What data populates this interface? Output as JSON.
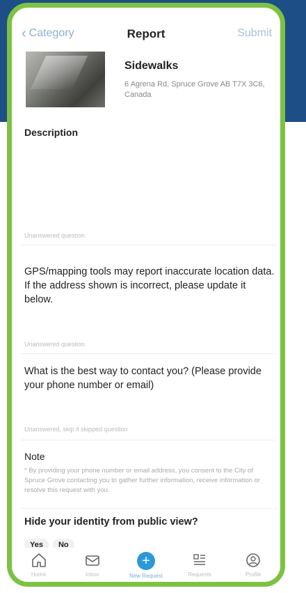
{
  "nav": {
    "back_label": "Category",
    "title": "Report",
    "submit_label": "Submit"
  },
  "report": {
    "category": "Sidewalks",
    "address": "6 Agrena Rd, Spruce Grove AB T7X 3C6, Canada"
  },
  "description": {
    "label": "Description",
    "hint": "Unanswered question"
  },
  "gps": {
    "question": "GPS/mapping tools may report inaccurate location data. If the address shown is incorrect, please update it below.",
    "hint": "Unanswered question"
  },
  "contact": {
    "question": "What is the best way to contact you? (Please provide your phone number or email)",
    "hint": "Unanswered, skip if skipped question"
  },
  "note": {
    "label": "Note",
    "text": "* By providing your phone number or email address, you consent to the City of Spruce Grove contacting you to gather further information, receive information or resolve this request with you."
  },
  "identity": {
    "question": "Hide your identity from public view?",
    "yes": "Yes",
    "no": "No"
  },
  "tabs": [
    {
      "label": "Home",
      "icon": "home-icon"
    },
    {
      "label": "Inbox",
      "icon": "mail-icon"
    },
    {
      "label": "New Request",
      "icon": "plus-icon"
    },
    {
      "label": "Requests",
      "icon": "list-icon"
    },
    {
      "label": "Profile",
      "icon": "profile-icon"
    }
  ],
  "colors": {
    "frame": "#7dc243",
    "header_band": "#1d4e86",
    "accent": "#2a9ad6"
  }
}
